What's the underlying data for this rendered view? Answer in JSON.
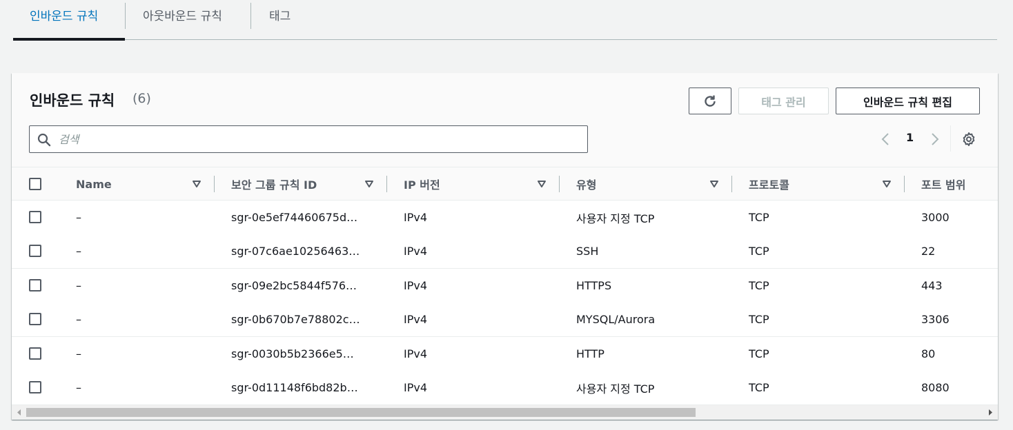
{
  "tabs": [
    {
      "label": "인바운드 규칙",
      "active": true
    },
    {
      "label": "아웃바운드 규칙",
      "active": false
    },
    {
      "label": "태그",
      "active": false
    }
  ],
  "panel": {
    "title": "인바운드 규칙",
    "count": "(6)",
    "buttons": {
      "refresh_icon": "refresh-icon",
      "manage_tags": "태그 관리",
      "edit_inbound": "인바운드 규칙 편집"
    },
    "search": {
      "placeholder": "검색",
      "value": ""
    },
    "pagination": {
      "current_page": "1"
    }
  },
  "table": {
    "columns": [
      "Name",
      "보안 그룹 규칙 ID",
      "IP 버전",
      "유형",
      "프로토콜",
      "포트 범위"
    ],
    "rows": [
      {
        "name": "–",
        "rule_id": "sgr-0e5ef74460675d…",
        "ip_version": "IPv4",
        "type": "사용자 지정 TCP",
        "protocol": "TCP",
        "port_range": "3000"
      },
      {
        "name": "–",
        "rule_id": "sgr-07c6ae10256463…",
        "ip_version": "IPv4",
        "type": "SSH",
        "protocol": "TCP",
        "port_range": "22"
      },
      {
        "name": "–",
        "rule_id": "sgr-09e2bc5844f576…",
        "ip_version": "IPv4",
        "type": "HTTPS",
        "protocol": "TCP",
        "port_range": "443"
      },
      {
        "name": "–",
        "rule_id": "sgr-0b670b7e78802c…",
        "ip_version": "IPv4",
        "type": "MYSQL/Aurora",
        "protocol": "TCP",
        "port_range": "3306"
      },
      {
        "name": "–",
        "rule_id": "sgr-0030b5b2366e5…",
        "ip_version": "IPv4",
        "type": "HTTP",
        "protocol": "TCP",
        "port_range": "80"
      },
      {
        "name": "–",
        "rule_id": "sgr-0d11148f6bd82b…",
        "ip_version": "IPv4",
        "type": "사용자 지정 TCP",
        "protocol": "TCP",
        "port_range": "8080"
      }
    ]
  },
  "colors": {
    "accent": "#0073bb",
    "text": "#16191f",
    "muted": "#545b64",
    "border": "#eaeded"
  }
}
